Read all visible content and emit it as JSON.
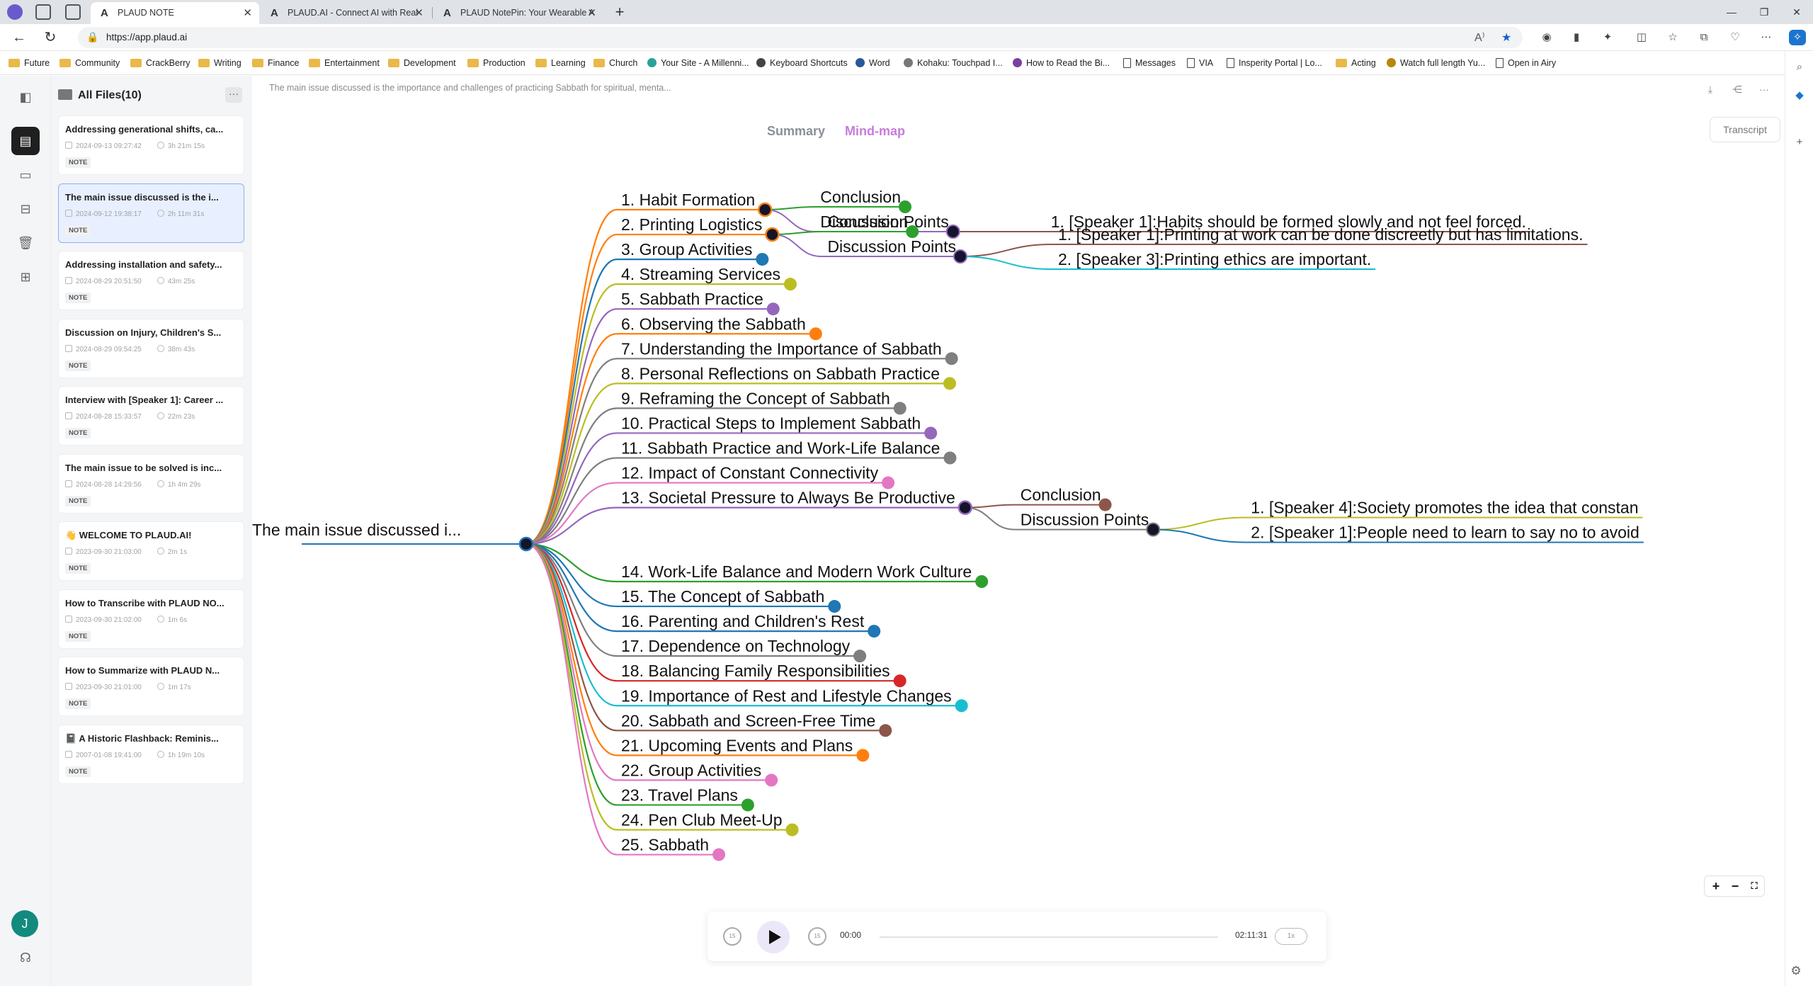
{
  "browser": {
    "tabs": [
      {
        "title": "PLAUD NOTE",
        "active": true
      },
      {
        "title": "PLAUD.AI - Connect AI with Real",
        "active": false
      },
      {
        "title": "PLAUD NotePin: Your Wearable A",
        "active": false
      }
    ],
    "url": "https://app.plaud.ai",
    "window_controls": [
      "minimize",
      "restore",
      "close"
    ]
  },
  "bookmarks": [
    {
      "label": "Future",
      "type": "folder"
    },
    {
      "label": "Community",
      "type": "folder"
    },
    {
      "label": "CrackBerry",
      "type": "folder"
    },
    {
      "label": "Writing",
      "type": "folder"
    },
    {
      "label": "Finance",
      "type": "folder"
    },
    {
      "label": "Entertainment",
      "type": "folder"
    },
    {
      "label": "Development",
      "type": "folder"
    },
    {
      "label": "Production",
      "type": "folder"
    },
    {
      "label": "Learning",
      "type": "folder"
    },
    {
      "label": "Church",
      "type": "folder"
    },
    {
      "label": "Your Site - A Millenni...",
      "type": "site"
    },
    {
      "label": "Keyboard Shortcuts",
      "type": "site"
    },
    {
      "label": "Word",
      "type": "site"
    },
    {
      "label": "Kohaku: Touchpad I...",
      "type": "site"
    },
    {
      "label": "How to Read the Bi...",
      "type": "site"
    },
    {
      "label": "Messages",
      "type": "page"
    },
    {
      "label": "VIA",
      "type": "page"
    },
    {
      "label": "Insperity Portal | Lo...",
      "type": "page"
    },
    {
      "label": "Acting",
      "type": "folder"
    },
    {
      "label": "Watch full length Yu...",
      "type": "site"
    },
    {
      "label": "Open in Airy",
      "type": "page"
    }
  ],
  "sidebar": {
    "header": "All Files(10)",
    "avatar_initial": "J",
    "files": [
      {
        "title": "Addressing generational shifts, ca...",
        "date": "2024-09-13 09:27:42",
        "duration": "3h 21m 15s",
        "tag": "NOTE"
      },
      {
        "title": "The main issue discussed is the i...",
        "date": "2024-09-12 19:38:17",
        "duration": "2h 11m 31s",
        "tag": "NOTE",
        "selected": true
      },
      {
        "title": "Addressing installation and safety...",
        "date": "2024-08-29 20:51:50",
        "duration": "43m 25s",
        "tag": "NOTE"
      },
      {
        "title": "Discussion on Injury, Children's S...",
        "date": "2024-08-29 09:54:25",
        "duration": "38m 43s",
        "tag": "NOTE"
      },
      {
        "title": "Interview with [Speaker 1]: Career ...",
        "date": "2024-08-28 15:33:57",
        "duration": "22m 23s",
        "tag": "NOTE"
      },
      {
        "title": "The main issue to be solved is inc...",
        "date": "2024-08-28 14:29:56",
        "duration": "1h 4m 29s",
        "tag": "NOTE"
      },
      {
        "title": "👋 WELCOME TO PLAUD.AI!",
        "date": "2023-09-30 21:03:00",
        "duration": "2m 1s",
        "tag": "NOTE"
      },
      {
        "title": "How to Transcribe with PLAUD NO...",
        "date": "2023-09-30 21:02:00",
        "duration": "1m 6s",
        "tag": "NOTE"
      },
      {
        "title": "How to Summarize with PLAUD N...",
        "date": "2023-09-30 21:01:00",
        "duration": "1m 17s",
        "tag": "NOTE"
      },
      {
        "title": "📓 A Historic Flashback: Reminis...",
        "date": "2007-01-08 19:41:00",
        "duration": "1h 19m 10s",
        "tag": "NOTE"
      }
    ]
  },
  "note": {
    "title": "The main issue discussed is the importance and challenges of practicing Sabbath for spiritual, menta...",
    "view_tabs": {
      "summary": "Summary",
      "mindmap": "Mind-map"
    },
    "transcript_label": "Transcript"
  },
  "mindmap": {
    "root": "The main issue discussed i...",
    "topics": [
      {
        "label": "1. Habit Formation",
        "color": "#ff7f0e"
      },
      {
        "label": "2. Printing Logistics",
        "color": "#ff7f0e"
      },
      {
        "label": "3. Group Activities",
        "color": "#1f77b4"
      },
      {
        "label": "4. Streaming Services",
        "color": "#bcbd22"
      },
      {
        "label": "5. Sabbath Practice",
        "color": "#9467bd"
      },
      {
        "label": "6. Observing the Sabbath",
        "color": "#ff7f0e"
      },
      {
        "label": "7. Understanding the Importance of Sabbath",
        "color": "#7f7f7f"
      },
      {
        "label": "8. Personal Reflections on Sabbath Practice",
        "color": "#bcbd22"
      },
      {
        "label": "9. Reframing the Concept of Sabbath",
        "color": "#7f7f7f"
      },
      {
        "label": "10. Practical Steps to Implement Sabbath",
        "color": "#9467bd"
      },
      {
        "label": "11. Sabbath Practice and Work-Life Balance",
        "color": "#7f7f7f"
      },
      {
        "label": "12. Impact of Constant Connectivity",
        "color": "#e377c2"
      },
      {
        "label": "13. Societal Pressure to Always Be Productive",
        "color": "#9467bd"
      },
      {
        "label": "14. Work-Life Balance and Modern Work Culture",
        "color": "#2ca02c"
      },
      {
        "label": "15. The Concept of Sabbath",
        "color": "#1f77b4"
      },
      {
        "label": "16. Parenting and Children's Rest",
        "color": "#1f77b4"
      },
      {
        "label": "17. Dependence on Technology",
        "color": "#7f7f7f"
      },
      {
        "label": "18. Balancing Family Responsibilities",
        "color": "#d62728"
      },
      {
        "label": "19. Importance of Rest and Lifestyle Changes",
        "color": "#17becf"
      },
      {
        "label": "20. Sabbath and Screen-Free Time",
        "color": "#8c564b"
      },
      {
        "label": "21. Upcoming Events and Plans",
        "color": "#ff7f0e"
      },
      {
        "label": "22. Group Activities",
        "color": "#e377c2"
      },
      {
        "label": "23. Travel Plans",
        "color": "#2ca02c"
      },
      {
        "label": "24. Pen Club Meet-Up",
        "color": "#bcbd22"
      },
      {
        "label": "25. Sabbath",
        "color": "#e377c2"
      }
    ],
    "expanded": [
      {
        "topic_index": 0,
        "conclusion": {
          "label": "Conclusion",
          "color": "#2ca02c"
        },
        "discussion": {
          "label": "Discussion Points",
          "color": "#9467bd"
        },
        "points": [
          {
            "label": "1. [Speaker 1]:Habits should be formed slowly and not feel forced.",
            "color": "#8c564b"
          }
        ]
      },
      {
        "topic_index": 1,
        "conclusion": {
          "label": "Conclusion",
          "color": "#2ca02c"
        },
        "discussion": {
          "label": "Discussion Points",
          "color": "#9467bd"
        },
        "points": [
          {
            "label": "1. [Speaker 1]:Printing at work can be done discreetly but has limitations.",
            "color": "#8c564b"
          },
          {
            "label": "2. [Speaker 3]:Printing ethics are important.",
            "color": "#17becf"
          }
        ]
      },
      {
        "topic_index": 12,
        "conclusion": {
          "label": "Conclusion",
          "color": "#8c564b"
        },
        "discussion": {
          "label": "Discussion Points",
          "color": "#7f7f7f"
        },
        "points": [
          {
            "label": "1. [Speaker 4]:Society promotes the idea that constan",
            "color": "#bcbd22"
          },
          {
            "label": "2. [Speaker 1]:People need to learn to say no to avoid",
            "color": "#1f77b4"
          }
        ]
      }
    ]
  },
  "zoom_controls": [
    "+",
    "−",
    "fit"
  ],
  "player": {
    "current_time": "00:00",
    "total_time": "02:11:31",
    "speed": "1x",
    "progress": 0
  },
  "colors": {
    "accent_purple": "#c57dd8",
    "selected_card_bg": "#e8efff",
    "avatar_bg": "#138a7e"
  }
}
